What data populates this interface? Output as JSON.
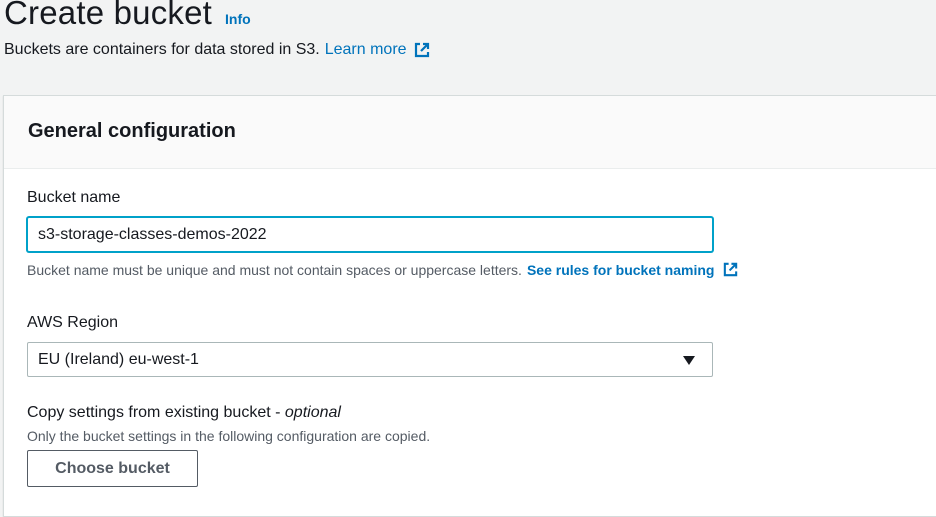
{
  "header": {
    "title": "Create bucket",
    "info_label": "Info",
    "subtitle": "Buckets are containers for data stored in S3.",
    "learn_more": "Learn more"
  },
  "panel": {
    "title": "General configuration",
    "bucket_name": {
      "label": "Bucket name",
      "value": "s3-storage-classes-demos-2022",
      "hint": "Bucket name must be unique and must not contain spaces or uppercase letters.",
      "rules_link": "See rules for bucket naming"
    },
    "region": {
      "label": "AWS Region",
      "selected": "EU (Ireland) eu-west-1"
    },
    "copy_settings": {
      "label": "Copy settings from existing bucket - ",
      "optional": "optional",
      "description": "Only the bucket settings in the following configuration are copied.",
      "button": "Choose bucket"
    }
  },
  "colors": {
    "link": "#0073bb",
    "focus": "#00a1c9",
    "background": "#f2f3f3"
  },
  "icons": [
    "external-link-icon",
    "dropdown-caret-icon"
  ]
}
